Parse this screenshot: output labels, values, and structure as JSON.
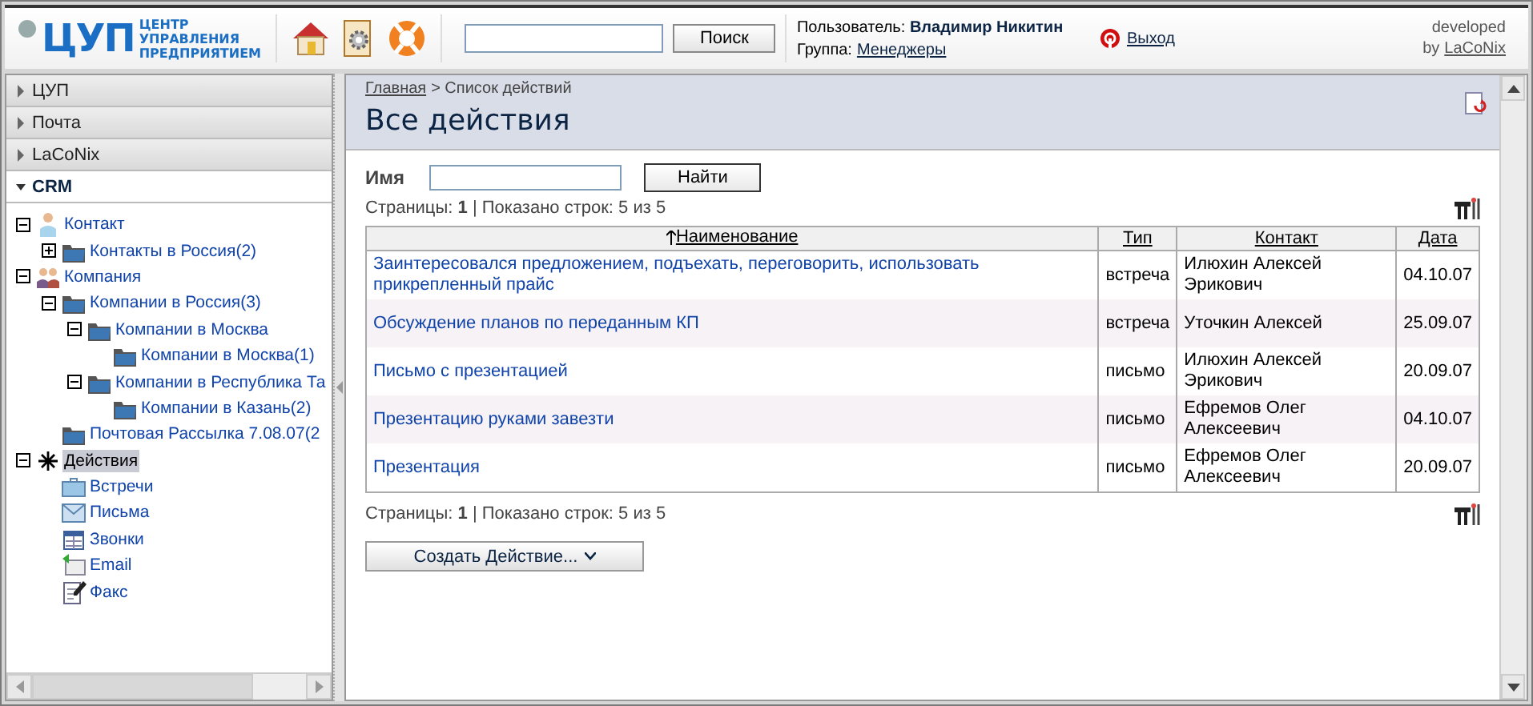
{
  "header": {
    "logo": {
      "mark": "ЦУП",
      "lines": [
        "ЦЕНТР",
        "УПРАВЛЕНИЯ",
        "ПРЕДПРИЯТИЕМ"
      ]
    },
    "tools": [
      {
        "kind": "home"
      },
      {
        "kind": "settings"
      },
      {
        "kind": "help"
      }
    ],
    "search": {
      "button": "Поиск"
    },
    "user": {
      "label": "Пользователь:",
      "name": "Владимир Никитин"
    },
    "group": {
      "label": "Группа:",
      "name": "Менеджеры"
    },
    "logout": "Выход",
    "credit": {
      "line1": "developed",
      "by": "by",
      "link": "LaCoNix"
    }
  },
  "sidebar": {
    "sections": [
      {
        "label": "ЦУП",
        "expanded": false
      },
      {
        "label": "Почта",
        "expanded": false
      },
      {
        "label": "LaCoNix",
        "expanded": false
      },
      {
        "label": "CRM",
        "expanded": true
      }
    ],
    "tree": [
      {
        "label": "Контакт",
        "kind": "person",
        "expanded": true,
        "selected": false,
        "children": [
          {
            "label": "Контакты в Россия(2)",
            "kind": "folder",
            "expanded": false,
            "selected": false
          }
        ]
      },
      {
        "label": "Компания",
        "kind": "group",
        "expanded": true,
        "selected": false,
        "children": [
          {
            "label": "Компании в Россия(3)",
            "kind": "folder",
            "expanded": true,
            "selected": false,
            "children": [
              {
                "label": "Компании в Москва",
                "kind": "folder",
                "expanded": true,
                "selected": false,
                "children": [
                  {
                    "label": "Компании в Москва(1)",
                    "kind": "folder",
                    "selected": false
                  }
                ]
              },
              {
                "label": "Компании в Республика Та",
                "kind": "folder",
                "expanded": true,
                "selected": false,
                "children": [
                  {
                    "label": "Компании в Казань(2)",
                    "kind": "folder",
                    "selected": false
                  }
                ]
              }
            ]
          },
          {
            "label": "Почтовая Рассылка 7.08.07(2",
            "kind": "folder",
            "selected": false
          }
        ]
      },
      {
        "label": "Действия",
        "kind": "star",
        "expanded": true,
        "selected": true,
        "children": [
          {
            "label": "Встречи",
            "kind": "briefcase",
            "selected": false
          },
          {
            "label": "Письма",
            "kind": "letter",
            "selected": false
          },
          {
            "label": "Звонки",
            "kind": "calendar",
            "selected": false
          },
          {
            "label": "Email",
            "kind": "email",
            "selected": false
          },
          {
            "label": "Факс",
            "kind": "note",
            "selected": false
          }
        ]
      }
    ]
  },
  "content": {
    "breadcrumb": {
      "link": "Главная",
      "current": "> Список действий"
    },
    "title": "Все действия",
    "filter": {
      "label": "Имя",
      "button": "Найти"
    },
    "pager_top": "Страницы: **1**  | Показано строк: 5 из 5",
    "table": {
      "columns": [
        {
          "label": "Наименование",
          "sorted": true
        },
        {
          "label": "Тип",
          "sorted": false
        },
        {
          "label": "Контакт",
          "sorted": false
        },
        {
          "label": "Дата",
          "sorted": false
        }
      ],
      "rows": [
        {
          "name": "Заинтересовался предложением, подъехать, переговорить, использовать прикрепленный прайс",
          "type": "встреча",
          "contact": "Илюхин Алексей Эрикович",
          "date": "04.10.07"
        },
        {
          "name": "Обсуждение планов по переданным КП",
          "type": "встреча",
          "contact": "Уточкин Алексей",
          "date": "25.09.07"
        },
        {
          "name": "Письмо с презентацией",
          "type": "письмо",
          "contact": "Илюхин Алексей Эрикович",
          "date": "20.09.07"
        },
        {
          "name": "Презентацию руками завезти",
          "type": "письмо",
          "contact": "Ефремов Олег Алексеевич",
          "date": "04.10.07"
        },
        {
          "name": "Презентация",
          "type": "письмо",
          "contact": "Ефремов Олег Алексеевич",
          "date": "20.09.07"
        }
      ]
    },
    "pager_bottom": "Страницы: **1**  | Показано строк: 5 из 5",
    "create_button": "Создать Действие..."
  }
}
